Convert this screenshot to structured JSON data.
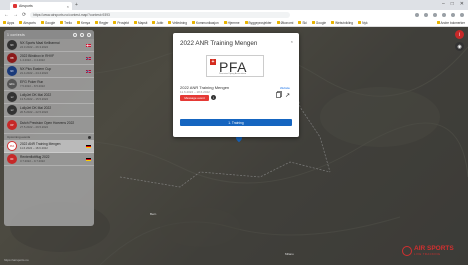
{
  "browser": {
    "tab_title": "Airsports",
    "url": "https://www.airsports.no/contest-map/?contest=9393",
    "new_tab_symbol": "+",
    "window_controls": [
      "–",
      "□",
      "✕"
    ],
    "nav": [
      "←",
      "→",
      "⟳"
    ]
  },
  "bookmarks": {
    "items": [
      "Apps",
      "Airsports",
      "Google",
      "Trello",
      "Kenya",
      "Regjer",
      "Prosjekt",
      "Mapsit",
      "Jobb",
      "Veiledning",
      "Kommunikasjon",
      "Hjemme",
      "Byggeprosjekter",
      "Økonomi",
      "Ski",
      "Google",
      "Webutvikling",
      "Nyk"
    ],
    "other": "Andre bokmerker"
  },
  "sidebar": {
    "count_label": "1 contests",
    "items": [
      {
        "name": "NX Sports Maal Keilbarmai",
        "date": "24.3.2022 – 26.3.2022",
        "logo": "NX",
        "logo_color": "#333333",
        "flag": "denmark"
      },
      {
        "name": "2022 Blinkbox in RHVF",
        "date": "1.4.2022 – 3.4.2022",
        "logo": "BB",
        "logo_color": "#8b1a1a",
        "flag": "norway"
      },
      {
        "name": "NX Plus Eastern Cup",
        "date": "21.4.2022 – 24.4.2022",
        "logo": "NX",
        "logo_color": "#1a3a7a",
        "flag": "norway"
      },
      {
        "name": "EFG Poker Run",
        "date": "7.5.2022 – 8.5.2022",
        "logo": "EFG",
        "logo_color": "#555555",
        "flag": "none"
      },
      {
        "name": "LollyJet DK Mai 2022",
        "date": "13.5.2022 – 15.5.2022",
        "logo": "LJ",
        "logo_color": "#333333",
        "flag": "none"
      },
      {
        "name": "LollyJet DK Mai 2022",
        "date": "20.5.2022 – 22.5.2022",
        "logo": "LJ",
        "logo_color": "#333333",
        "flag": "none"
      },
      {
        "name": "Dutch Precision Open Hoevens 2022",
        "date": "27.5.2022 – 29.5.2022",
        "logo": "DP",
        "logo_color": "#c62828",
        "flag": "none"
      }
    ],
    "section_label": "Upcoming events",
    "upcoming": [
      {
        "name": "2022 ANR Training Mengen",
        "date": "11.6.2022 – 18.6.2022",
        "logo": "PFA",
        "logo_color": "#d32f2f",
        "flag": "germany",
        "selected": true
      },
      {
        "name": "Rentenflottflug 2022",
        "date": "3.7.2022 – 9.7.2022",
        "logo": "RF",
        "logo_color": "#c62828",
        "flag": "germany",
        "selected": false
      }
    ]
  },
  "modal": {
    "title": "2022 ANR Training Mengen",
    "close": "×",
    "logo": {
      "mark": "+",
      "big": "PFA",
      "sub": "Precision Flying Association"
    },
    "contest_name": "2022 ANR Training Mengen",
    "date": "11.6.2022 – 18.6.2022",
    "website_label": "Website",
    "message_button": "Message event",
    "info_symbol": "i",
    "share_symbol": "↗",
    "join_button": "1. Training"
  },
  "map": {
    "labels": [
      {
        "text": "Bern"
      },
      {
        "text": "Milano"
      }
    ],
    "controls": [
      {
        "symbol": "i",
        "color": "#c62828"
      },
      {
        "symbol": "◉",
        "color": "#333333"
      }
    ],
    "brand": {
      "name": "AIR SPORTS",
      "tagline": "LIVE TRACKING"
    },
    "status": "https://airsports.no"
  }
}
